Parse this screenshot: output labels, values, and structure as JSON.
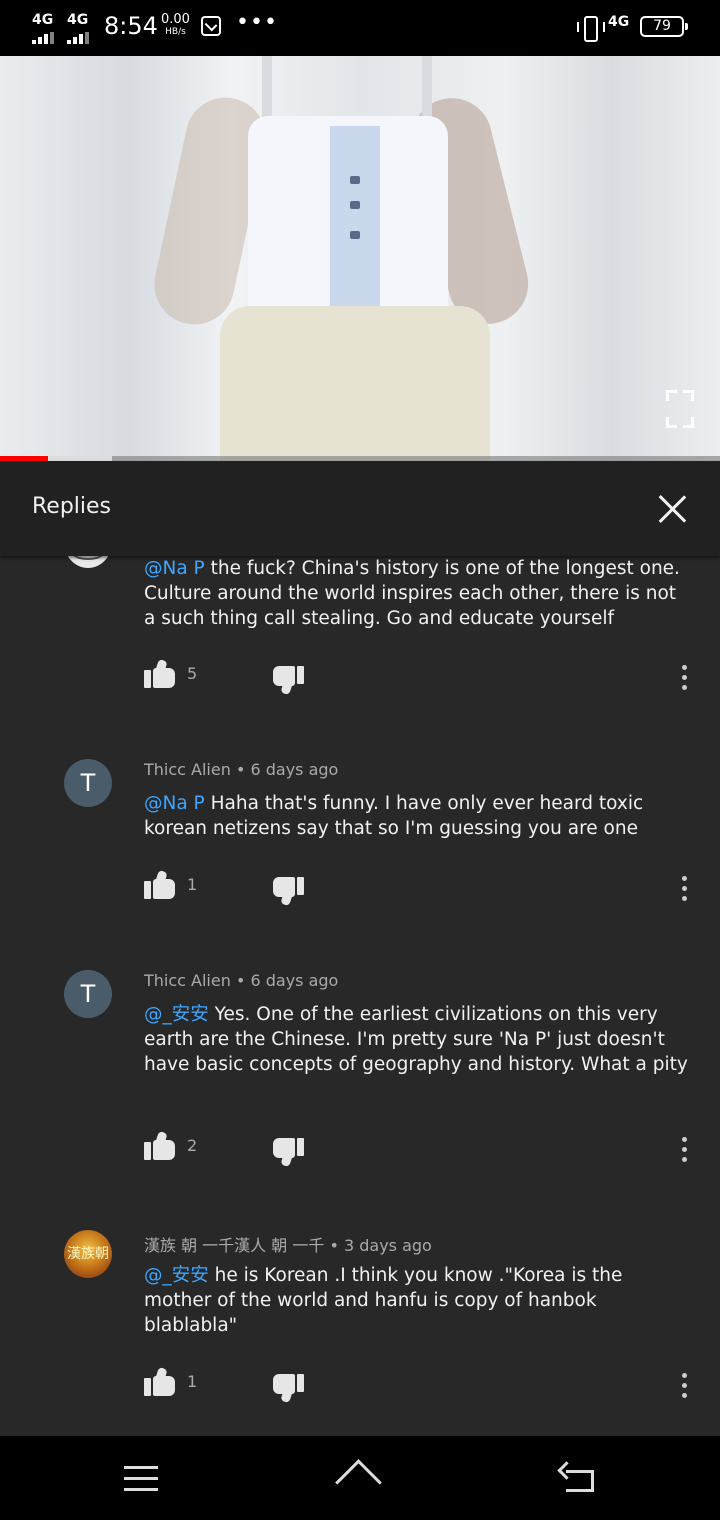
{
  "status_bar": {
    "signal1": "4G",
    "signal2": "4G",
    "time": "8:54",
    "speed_value": "0.00",
    "speed_unit": "HB/s",
    "more": "•••",
    "network": "4G",
    "battery": "79"
  },
  "video": {
    "progress_played": 0.067,
    "progress_buffered": 0.155
  },
  "replies": {
    "title": "Replies"
  },
  "comments": [
    {
      "mention": "@Na P",
      "text": " the fuck? China's history is one of the longest one. Culture around the world inspires each other, there is not a such thing call stealing. Go and educate yourself",
      "likes": "5"
    },
    {
      "avatar_letter": "T",
      "author": "Thicc Alien",
      "time": "6 days ago",
      "mention": "@Na P",
      "text": " Haha that's funny. I have only ever heard toxic korean netizens say that so I'm guessing you are one",
      "likes": "1"
    },
    {
      "avatar_letter": "T",
      "author": "Thicc Alien",
      "time": "6 days ago",
      "mention": "@_安安",
      "text": " Yes. One of the earliest civilizations on this very earth are the Chinese. I'm pretty sure 'Na P' just doesn't have basic concepts of geography and history. What a pity",
      "likes": "2"
    },
    {
      "avatar_text": "漢族朝",
      "author": "漢族 朝 一千漢人 朝 一千",
      "time": "3 days ago",
      "mention": "@_安安",
      "text": " he is Korean .I think you know .\"Korea is the mother of the world and hanfu is copy of hanbok blablabla\"",
      "likes": "1"
    }
  ],
  "separator": " • "
}
